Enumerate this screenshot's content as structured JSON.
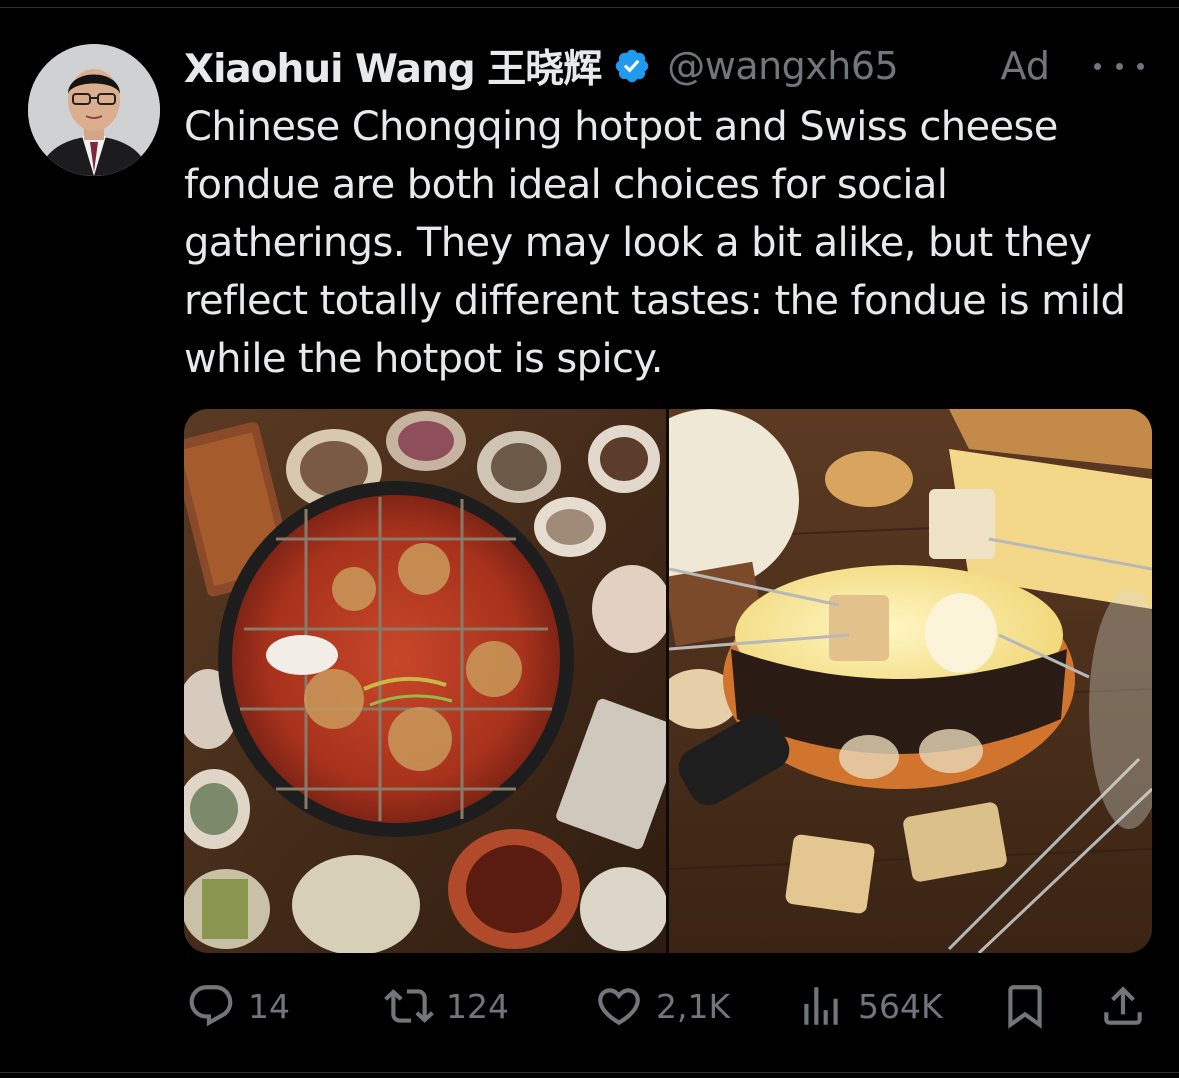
{
  "tweet": {
    "author": {
      "display_name": "Xiaohui Wang 王晓辉",
      "handle": "@wangxh65",
      "verified": true
    },
    "ad_label": "Ad",
    "text": "Chinese Chongqing hotpot and Swiss cheese fondue are both ideal choices for social gatherings. They may look a bit alike, but they reflect totally different tastes: the fondue is mild while the hotpot is spicy.",
    "media": [
      {
        "subject": "Chongqing hotpot"
      },
      {
        "subject": "Swiss cheese fondue"
      }
    ],
    "actions": {
      "replies": "14",
      "reposts": "124",
      "likes": "2,1K",
      "views": "564K"
    }
  },
  "colors": {
    "background": "#000000",
    "text_primary": "#e7e9ea",
    "text_secondary": "#71767b",
    "verified_badge": "#1d9bf0",
    "divider": "#2f3336"
  },
  "icons": [
    "more-icon",
    "verified-badge-icon",
    "reply-icon",
    "repost-icon",
    "like-icon",
    "views-icon",
    "bookmark-icon",
    "share-icon"
  ]
}
